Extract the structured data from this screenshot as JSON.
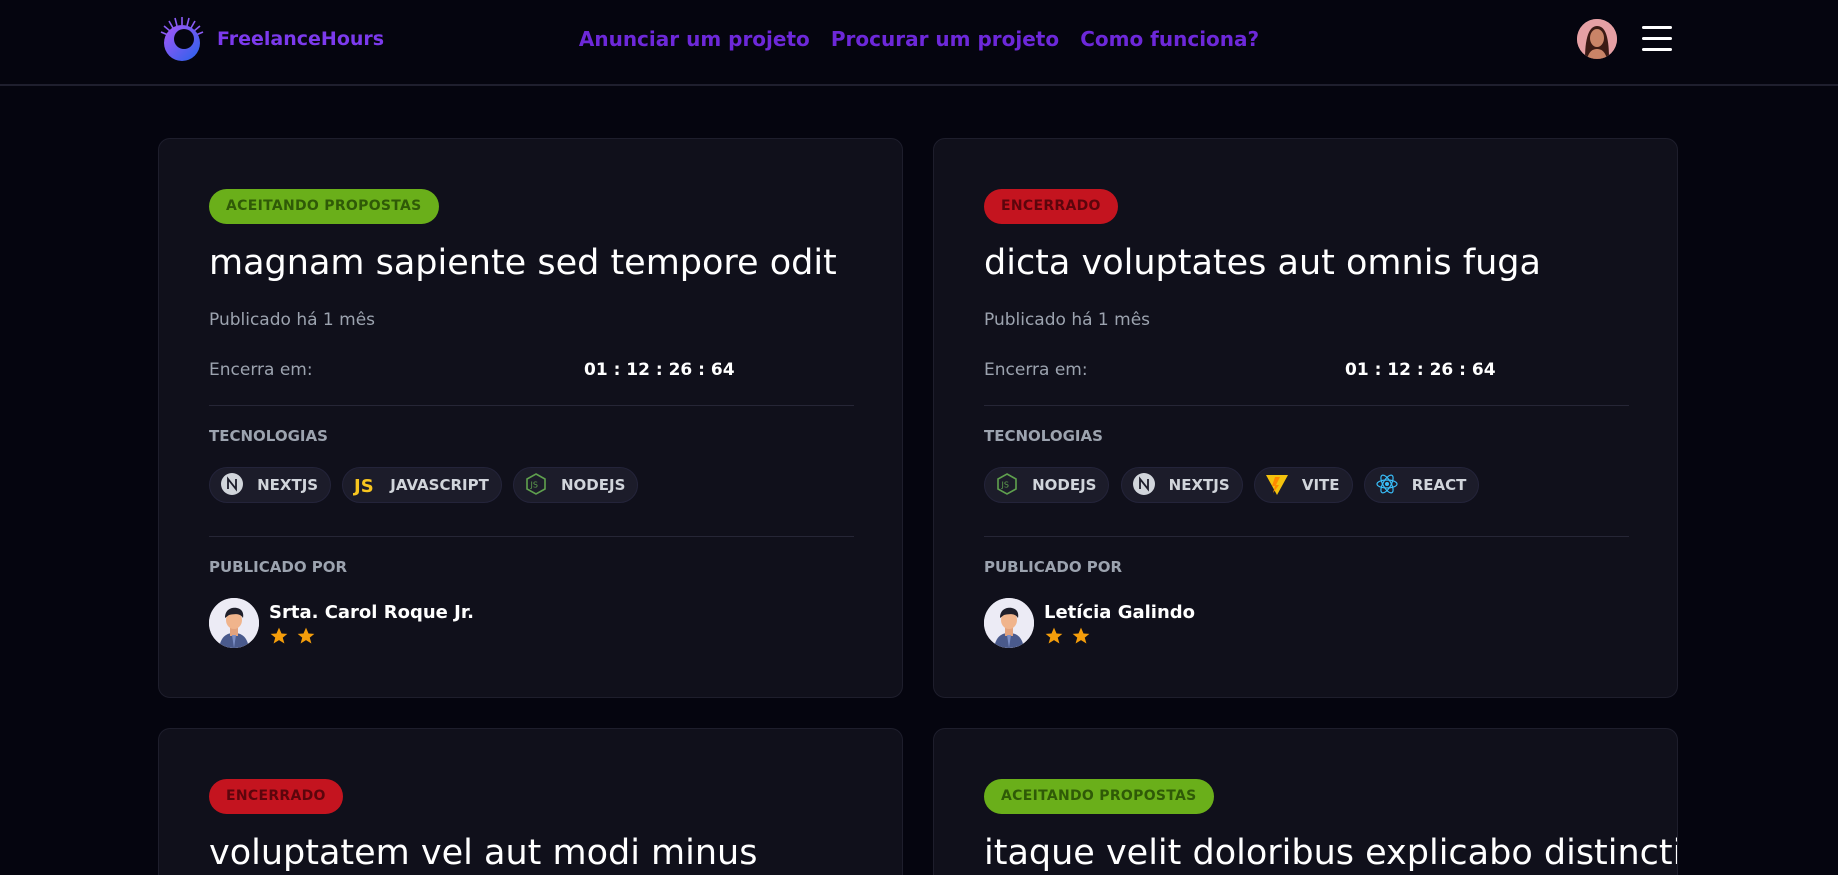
{
  "header": {
    "brand": "FreelanceHours",
    "nav": [
      "Anunciar um projeto",
      "Procurar um projeto",
      "Como funciona?"
    ]
  },
  "colors": {
    "background": "#05050f",
    "card": "#10101b",
    "brand_purple": "#6d28d9",
    "badge_open": "#6aaf1a",
    "badge_closed": "#c4141f",
    "star": "#f59e0b"
  },
  "projects": [
    {
      "status": "ACEITANDO PROPOSTAS",
      "status_type": "open",
      "title": "magnam sapiente sed tempore odit",
      "published": "Publicado há 1 mês",
      "ends_label": "Encerra em:",
      "countdown": "01 : 12 : 26 : 64",
      "tech_label": "TECNOLOGIAS",
      "techs": [
        {
          "name": "NEXTJS",
          "icon": "nextjs-icon"
        },
        {
          "name": "JAVASCRIPT",
          "icon": "javascript-icon"
        },
        {
          "name": "NODEJS",
          "icon": "nodejs-icon"
        }
      ],
      "author_label": "PUBLICADO POR",
      "author": "Srta. Carol Roque Jr.",
      "stars": 2
    },
    {
      "status": "ENCERRADO",
      "status_type": "closed",
      "title": "dicta voluptates aut omnis fuga",
      "published": "Publicado há 1 mês",
      "ends_label": "Encerra em:",
      "countdown": "01 : 12 : 26 : 64",
      "tech_label": "TECNOLOGIAS",
      "techs": [
        {
          "name": "NODEJS",
          "icon": "nodejs-icon"
        },
        {
          "name": "NEXTJS",
          "icon": "nextjs-icon"
        },
        {
          "name": "VITE",
          "icon": "vite-icon"
        },
        {
          "name": "REACT",
          "icon": "react-icon"
        }
      ],
      "author_label": "PUBLICADO POR",
      "author": "Letícia Galindo",
      "stars": 2
    },
    {
      "status": "ENCERRADO",
      "status_type": "closed",
      "title": "voluptatem vel aut modi minus"
    },
    {
      "status": "ACEITANDO PROPOSTAS",
      "status_type": "open",
      "title": "itaque velit doloribus explicabo distinctio"
    }
  ]
}
